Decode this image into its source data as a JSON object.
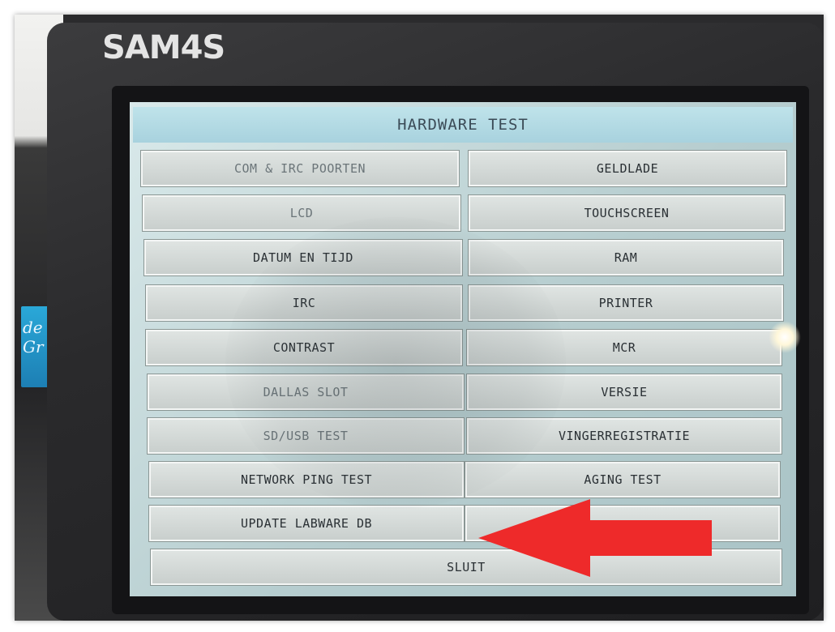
{
  "brand": {
    "name": "SAM4S"
  },
  "background_sign": {
    "text": "de Gr"
  },
  "screen": {
    "title": "HARDWARE TEST",
    "buttons_left": [
      "COM & IRC POORTEN",
      "LCD",
      "DATUM EN TIJD",
      "IRC",
      "CONTRAST",
      "DALLAS SLOT",
      "SD/USB TEST",
      "NETWORK PING TEST",
      "UPDATE LABWARE DB"
    ],
    "buttons_right": [
      "GELDLADE",
      "TOUCHSCREEN",
      "RAM",
      "PRINTER",
      "MCR",
      "VERSIE",
      "VINGERREGISTRATIE",
      "AGING TEST",
      ""
    ],
    "close_button": "SLUIT"
  },
  "annotation": {
    "arrow_color": "#ee2a2a",
    "arrow_direction": "left"
  }
}
